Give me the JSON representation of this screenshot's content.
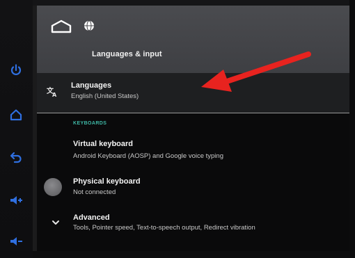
{
  "header": {
    "title": "Languages & input",
    "icons": [
      "home-outline-icon",
      "globe-icon"
    ]
  },
  "side_buttons": [
    "power-icon",
    "home-icon",
    "back-icon",
    "volume-up-icon",
    "volume-down-icon"
  ],
  "languages": {
    "title": "Languages",
    "subtitle": "English (United States)",
    "icon": "translate-icon"
  },
  "keyboards": {
    "section_label": "KEYBOARDS",
    "virtual": {
      "title": "Virtual keyboard",
      "subtitle": "Android Keyboard (AOSP) and Google voice typing"
    },
    "physical": {
      "title": "Physical keyboard",
      "subtitle": "Not connected"
    }
  },
  "advanced": {
    "title": "Advanced",
    "subtitle": "Tools, Pointer speed, Text-to-speech output, Redirect vibration",
    "icon": "chevron-down-icon"
  },
  "colors": {
    "accent": "#3fb8a6",
    "side_button": "#2f6fe0",
    "arrow": "#e8231f",
    "app_bar": "#45464a"
  }
}
